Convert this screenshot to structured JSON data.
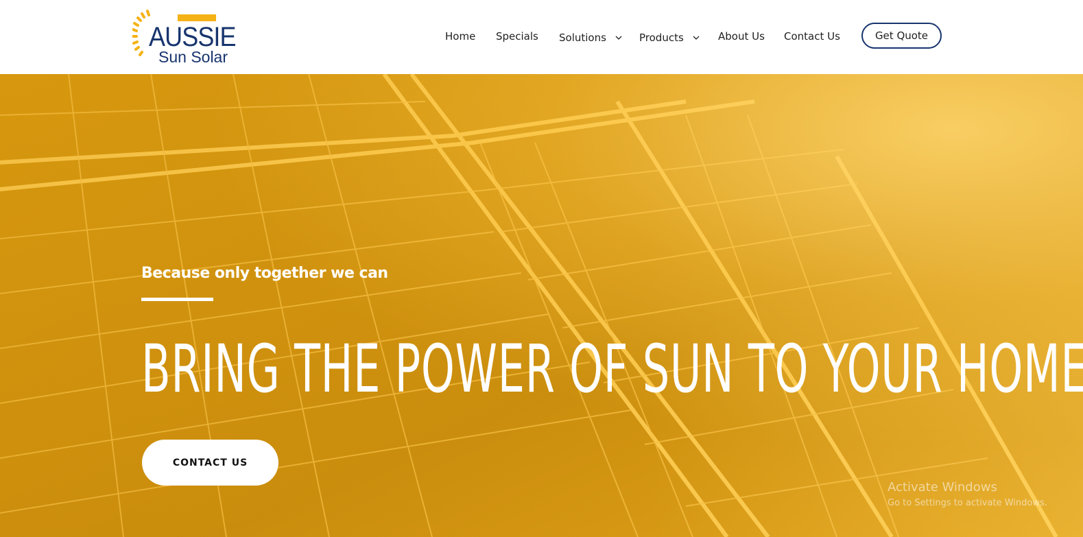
{
  "brand": {
    "name_line1": "AUSSIE",
    "name_line2": "Sun Solar",
    "logo_icon": "sun-rays-icon",
    "colors": {
      "navy": "#17346d",
      "gold": "#f5b214"
    }
  },
  "nav": {
    "items": [
      {
        "label": "Home",
        "dropdown": false
      },
      {
        "label": "Specials",
        "dropdown": false
      },
      {
        "label": "Solutions",
        "dropdown": true
      },
      {
        "label": "Products",
        "dropdown": true
      },
      {
        "label": "About Us",
        "dropdown": false
      },
      {
        "label": "Contact Us",
        "dropdown": false
      }
    ],
    "cta_label": "Get Quote"
  },
  "hero": {
    "tagline": "Because only together we can",
    "headline": "BRING THE POWER OF SUN TO YOUR HOME",
    "cta_label": "CONTACT US",
    "background_color": "#e7a81b"
  },
  "watermark": {
    "title": "Activate Windows",
    "subtitle": "Go to Settings to activate Windows."
  }
}
